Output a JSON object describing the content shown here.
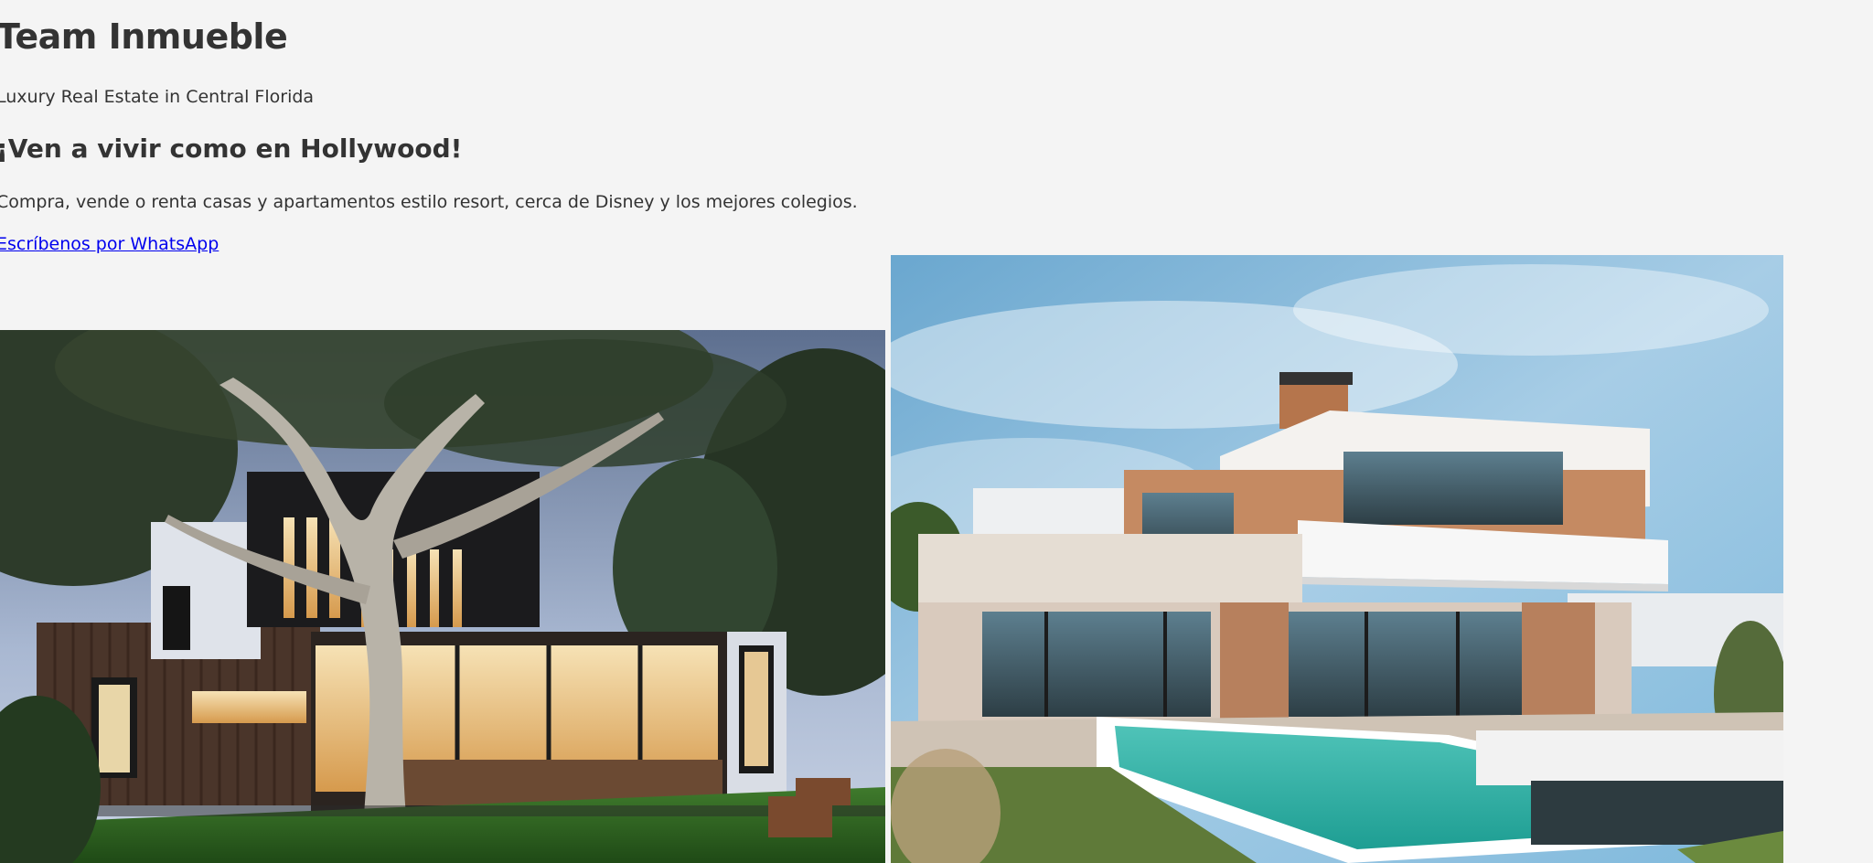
{
  "header": {
    "title": "Team Inmueble",
    "tagline": "Luxury Real Estate in Central Florida"
  },
  "hero": {
    "headline": "¡Ven a vivir como en Hollywood!",
    "description": "Compra, vende o renta casas y apartamentos estilo resort, cerca de Disney y los mejores colegios.",
    "whatsapp_link": "Escríbenos por WhatsApp"
  },
  "gallery": {
    "images": [
      {
        "subject": "modern-house-dusk-photo"
      },
      {
        "subject": "villa-with-pool-photo"
      }
    ]
  }
}
